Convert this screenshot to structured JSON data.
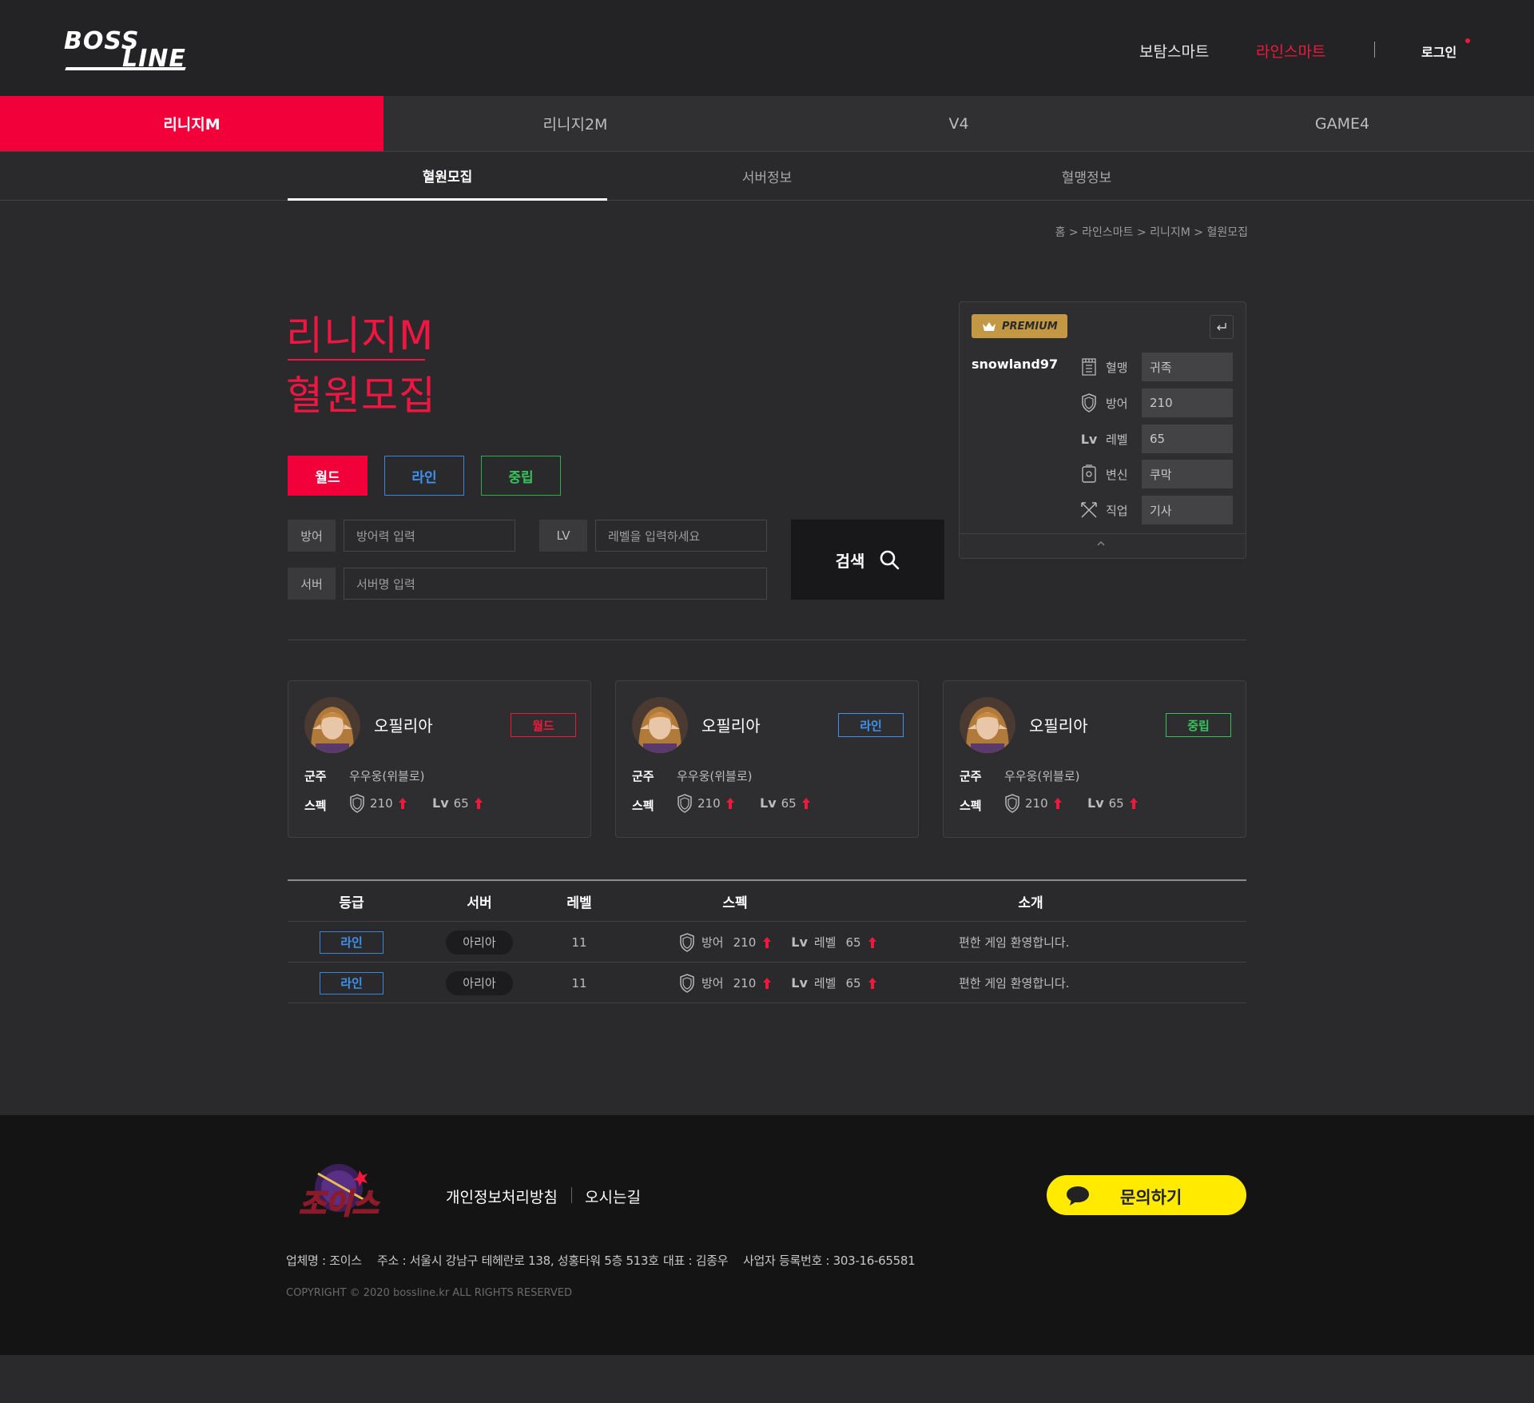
{
  "header": {
    "logo_top": "BOSS",
    "logo_bottom": "LINE",
    "nav": [
      "보탐스마트",
      "라인스마트"
    ],
    "login": "로그인"
  },
  "game_tabs": [
    "리니지M",
    "리니지2M",
    "V4",
    "GAME4"
  ],
  "sub_tabs": [
    "혈원모집",
    "서버정보",
    "혈맹정보"
  ],
  "breadcrumb": "홈 > 라인스마트  >  리니지M  >  혈원모집",
  "title": {
    "line1": "리니지M",
    "line2": "혈원모집"
  },
  "type_buttons": [
    "월드",
    "라인",
    "중립"
  ],
  "filters": {
    "defense_label": "방어",
    "defense_placeholder": "방어력 입력",
    "lv_label": "LV",
    "lv_placeholder": "레벨을 입력하세요",
    "server_label": "서버",
    "server_placeholder": "서버명 입력",
    "search_label": "검색"
  },
  "premium_panel": {
    "badge": "PREMIUM",
    "username": "snowland97",
    "rows": [
      {
        "label": "혈맹",
        "value": "귀족",
        "icon": "clan-icon"
      },
      {
        "label": "방어",
        "value": "210",
        "icon": "shield-icon"
      },
      {
        "label": "레벨",
        "value": "65",
        "icon": "lv-icon",
        "icon_text": "Lv"
      },
      {
        "label": "변신",
        "value": "쿠막",
        "icon": "transform-icon"
      },
      {
        "label": "직업",
        "value": "기사",
        "icon": "crossed-swords-icon"
      }
    ]
  },
  "cards": [
    {
      "name": "오필리아",
      "badge": "월드",
      "lord_label": "군주",
      "lord": "우우웅(위블로)",
      "spec_label": "스펙",
      "defense": "210",
      "lv_text": "Lv",
      "level": "65"
    },
    {
      "name": "오필리아",
      "badge": "라인",
      "lord_label": "군주",
      "lord": "우우웅(위블로)",
      "spec_label": "스펙",
      "defense": "210",
      "lv_text": "Lv",
      "level": "65"
    },
    {
      "name": "오필리아",
      "badge": "중립",
      "lord_label": "군주",
      "lord": "우우웅(위블로)",
      "spec_label": "스펙",
      "defense": "210",
      "lv_text": "Lv",
      "level": "65"
    }
  ],
  "table": {
    "headers": [
      "등급",
      "서버",
      "레벨",
      "스펙",
      "소개"
    ],
    "rows": [
      {
        "grade": "라인",
        "server": "아리아",
        "level": "11",
        "def_label": "방어",
        "defense": "210",
        "lv_text": "Lv",
        "lvl_label": "레벨",
        "lvl": "65",
        "intro": "편한 게임 환영합니다."
      },
      {
        "grade": "라인",
        "server": "아리아",
        "level": "11",
        "def_label": "방어",
        "defense": "210",
        "lv_text": "Lv",
        "lvl_label": "레벨",
        "lvl": "65",
        "intro": "편한 게임 환영합니다."
      }
    ]
  },
  "footer": {
    "logo_text": "조이스",
    "links": [
      "개인정보처리방침",
      "오시는길"
    ],
    "inquiry": "문의하기",
    "company": "업체명 : 조이스",
    "address": "주소 :  서울시 강남구 테헤란로 138, 성홍타워 5층 513호",
    "ceo": "대표 : 김종우",
    "biz_no": "사업자 등록번호 : 303-16-65581",
    "copyright": "COPYRIGHT © 2020 bossline.kr ALL RIGHTS RESERVED"
  },
  "colors": {
    "accent": "#f1003a",
    "line_blue": "#3d93f0",
    "neutral_green": "#36c35a",
    "premium_gold": "#c39844",
    "kakao_yellow": "#ffea00"
  }
}
